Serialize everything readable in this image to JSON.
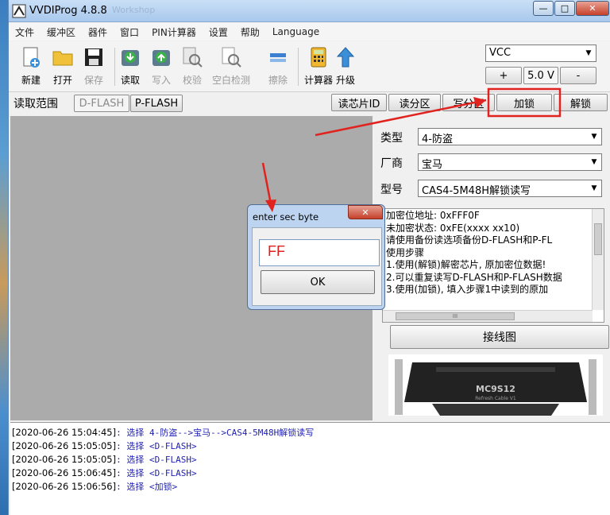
{
  "window": {
    "title": "VVDIProg 4.8.8",
    "title_ghost": "Workshop",
    "min": "—",
    "max": "□",
    "close": "✕"
  },
  "menu": [
    "文件",
    "缓冲区",
    "器件",
    "窗口",
    "PIN计算器",
    "设置",
    "帮助",
    "Language"
  ],
  "toolbar": {
    "new": "新建",
    "open": "打开",
    "save": "保存",
    "read": "读取",
    "write": "写入",
    "verify": "校验",
    "blank": "空白检测",
    "erase": "擦除",
    "calc": "计算器",
    "upgrade": "升级"
  },
  "vcc": {
    "select": "VCC",
    "plus": "+",
    "voltage": "5.0 V",
    "minus": "-"
  },
  "readrange": {
    "label": "读取范围",
    "dflash": "D-FLASH",
    "pflash": "P-FLASH"
  },
  "actions": {
    "read_id": "读芯片ID",
    "read_part": "读分区",
    "write_part": "写分区",
    "lock": "加锁",
    "unlock": "解锁"
  },
  "selectors": {
    "type_label": "类型",
    "type_value": "4-防盗",
    "maker_label": "厂商",
    "maker_value": "宝马",
    "model_label": "型号",
    "model_value": "CAS4-5M48H解锁读写"
  },
  "info_lines": [
    "加密位地址: 0xFFF0F",
    "未加密状态: 0xFE(xxxx xx10)",
    "请使用备份读选项备份D-FLASH和P-FL",
    "使用步骤",
    "1.使用(解锁)解密芯片, 原加密位数据!",
    "2.可以重复读写D-FLASH和P-FLASH数据",
    "3.使用(加锁), 填入步骤1中读到的原加"
  ],
  "scroll_mark": "III",
  "wiring_button": "接线图",
  "connector_label": "MC9S12",
  "connector_sub": "Refresh Cable V1",
  "dialog": {
    "title": "enter sec byte",
    "close": "✕",
    "value": "FF",
    "ok": "OK"
  },
  "log": [
    {
      "ts": "[2020-06-26 15:04:45]",
      "msg": ": 选择 4-防盗-->宝马-->CAS4-5M48H解锁读写"
    },
    {
      "ts": "[2020-06-26 15:05:05]",
      "msg": ": 选择 <D-FLASH>"
    },
    {
      "ts": "[2020-06-26 15:05:05]",
      "msg": ": 选择 <D-FLASH>"
    },
    {
      "ts": "[2020-06-26 15:06:45]",
      "msg": ": 选择 <D-FLASH>"
    },
    {
      "ts": "[2020-06-26 15:06:56]",
      "msg": ": 选择 <加锁>"
    }
  ],
  "colors": {
    "annotation": "#e0231f",
    "log_text": "#1d1db5"
  }
}
